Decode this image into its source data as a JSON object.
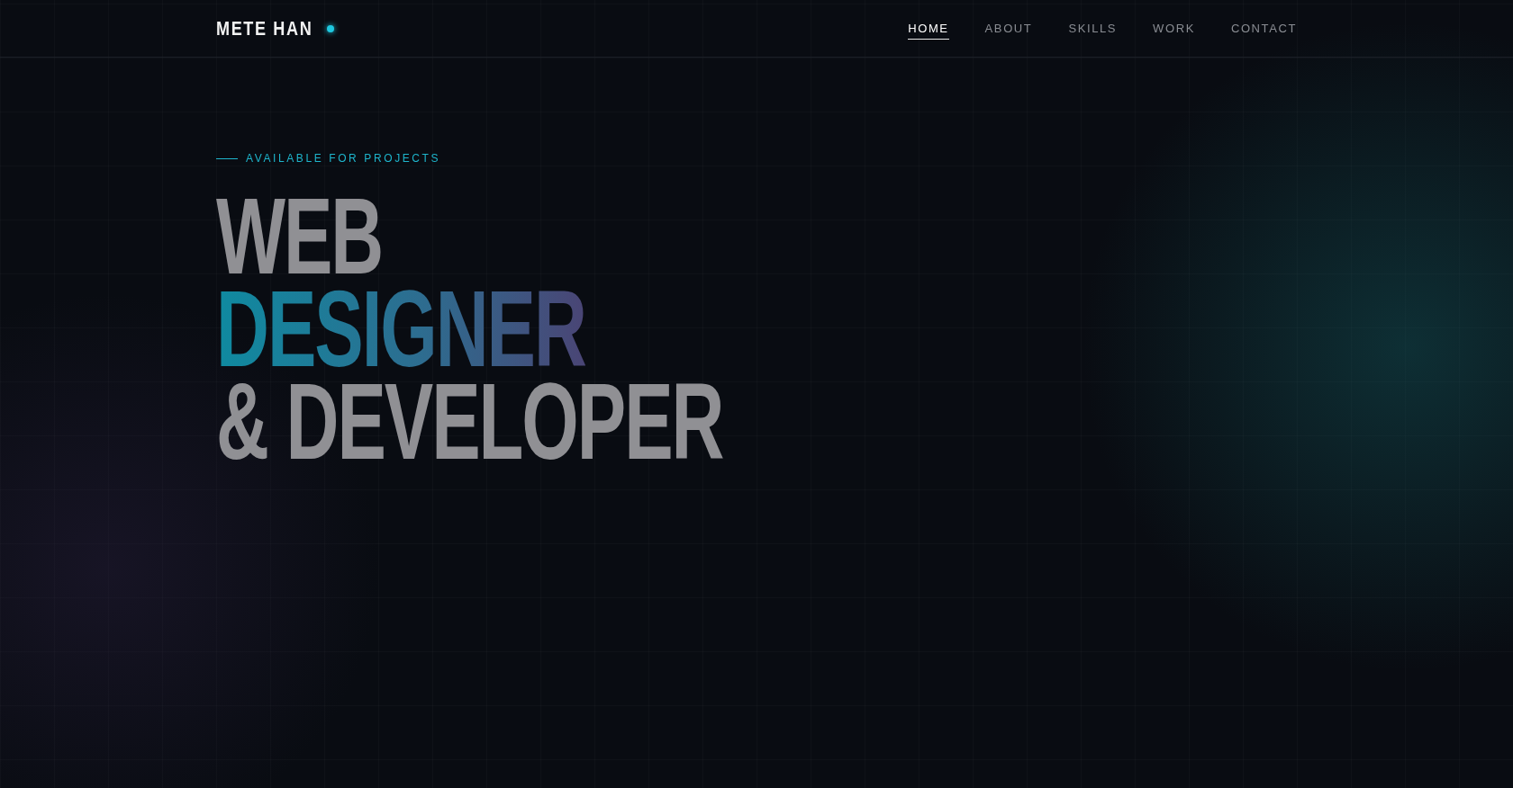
{
  "logo": {
    "text": "METE HAN"
  },
  "nav": [
    {
      "label": "HOME",
      "selected": true
    },
    {
      "label": "ABOUT",
      "selected": false
    },
    {
      "label": "SKILLS",
      "selected": false
    },
    {
      "label": "WORK",
      "selected": false
    },
    {
      "label": "CONTACT",
      "selected": false
    }
  ],
  "hero": {
    "eyebrow": "AVAILABLE FOR PROJECTS",
    "headline": [
      {
        "text": "WEB",
        "kind": "plain"
      },
      {
        "text": "DESIGNER",
        "kind": "gradient"
      },
      {
        "text": "& DEVELOPER",
        "kind": "plain"
      }
    ]
  }
}
